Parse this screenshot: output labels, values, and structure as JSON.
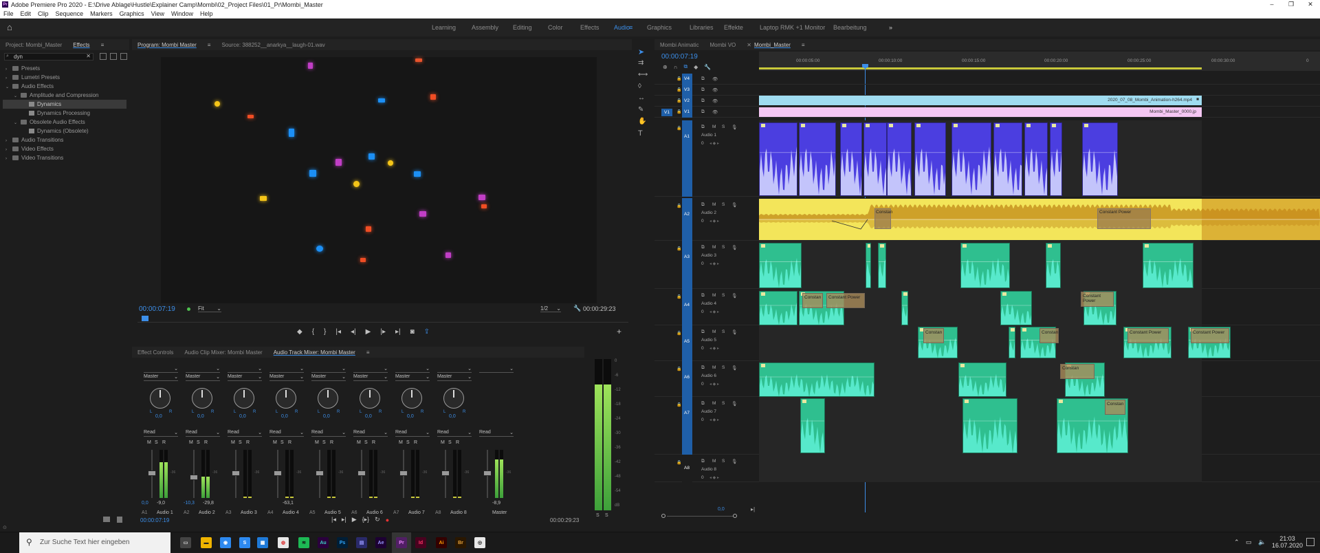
{
  "window": {
    "title": "Adobe Premiere Pro 2020 - E:\\Drive Ablage\\Hustle\\Explainer Camp\\Mombi\\02_Project Files\\01_Pr\\Mombi_Master",
    "min": "–",
    "max": "❐",
    "close": "✕"
  },
  "menu": [
    "File",
    "Edit",
    "Clip",
    "Sequence",
    "Markers",
    "Graphics",
    "View",
    "Window",
    "Help"
  ],
  "workspaces": [
    "Learning",
    "Assembly",
    "Editing",
    "Color",
    "Effects",
    "Audio",
    "Graphics",
    "Libraries",
    "Effekte",
    "Laptop RMK +1 Monitor",
    "Bearbeitung"
  ],
  "active_workspace": "Audio",
  "left_panel": {
    "tabs": [
      "Project: Mombi_Master",
      "Effects"
    ],
    "search_value": "dyn",
    "tree": [
      {
        "label": "Presets",
        "level": 0,
        "kind": "folder"
      },
      {
        "label": "Lumetri Presets",
        "level": 0,
        "kind": "folder"
      },
      {
        "label": "Audio Effects",
        "level": 0,
        "kind": "folder"
      },
      {
        "label": "Amplitude and Compression",
        "level": 1,
        "kind": "folder"
      },
      {
        "label": "Dynamics",
        "level": 2,
        "kind": "fx",
        "selected": true
      },
      {
        "label": "Dynamics Processing",
        "level": 2,
        "kind": "fx"
      },
      {
        "label": "Obsolete Audio Effects",
        "level": 1,
        "kind": "folder"
      },
      {
        "label": "Dynamics (Obsolete)",
        "level": 2,
        "kind": "fx"
      },
      {
        "label": "Audio Transitions",
        "level": 0,
        "kind": "folder"
      },
      {
        "label": "Video Effects",
        "level": 0,
        "kind": "folder"
      },
      {
        "label": "Video Transitions",
        "level": 0,
        "kind": "folder"
      }
    ]
  },
  "monitor": {
    "tab_program": "Program: Mombi Master",
    "tab_source": "Source: 388252__anarkya__laugh-01.wav",
    "timecode": "00:00:07:19",
    "fit": "Fit",
    "resolution": "1/2",
    "duration": "00:00:29:23"
  },
  "mixer": {
    "tabs": [
      "Effect Controls",
      "Audio Clip Mixer: Mombi Master",
      "Audio Track Mixer: Mombi Master"
    ],
    "timecode": "00:00:07:19",
    "duration": "00:00:29:23",
    "channels": [
      {
        "id": "A1",
        "name": "Audio 1",
        "output": "Master",
        "mode": "Read",
        "value": "-9,0",
        "pan": "0,0",
        "level": 0.75,
        "fader": 0.5
      },
      {
        "id": "A2",
        "name": "Audio 2",
        "output": "Master",
        "mode": "Read",
        "value": "-29,8",
        "vol": "-10,3",
        "pan": "0,0",
        "level": 0.45,
        "fader": 0.4
      },
      {
        "id": "A3",
        "name": "Audio 3",
        "output": "Master",
        "mode": "Read",
        "value": "",
        "pan": "0,0",
        "level": 0,
        "fader": 0.5
      },
      {
        "id": "A4",
        "name": "Audio 4",
        "output": "Master",
        "mode": "Read",
        "value": "-63,1",
        "pan": "0,0",
        "level": 0.05,
        "fader": 0.5
      },
      {
        "id": "A5",
        "name": "Audio 5",
        "output": "Master",
        "mode": "Read",
        "value": "",
        "pan": "0,0",
        "level": 0,
        "fader": 0.5
      },
      {
        "id": "A6",
        "name": "Audio 6",
        "output": "Master",
        "mode": "Read",
        "value": "",
        "pan": "0,0",
        "level": 0,
        "fader": 0.5
      },
      {
        "id": "A7",
        "name": "Audio 7",
        "output": "Master",
        "mode": "Read",
        "value": "",
        "pan": "0,0",
        "level": 0,
        "fader": 0.5
      },
      {
        "id": "A8",
        "name": "Audio 8",
        "output": "Master",
        "mode": "Read",
        "value": "",
        "pan": "0,0",
        "level": 0,
        "fader": 0.5
      },
      {
        "id": "M",
        "name": "Master",
        "output": "",
        "mode": "Read",
        "value": "-8,9",
        "pan": "",
        "level": 0.8,
        "fader": 0.5
      }
    ],
    "meter_scale": [
      "0",
      "-6",
      "-12",
      "-18",
      "-24",
      "-30",
      "-36",
      "-42",
      "-48",
      "-54",
      "dB"
    ],
    "sub_labels": [
      "0",
      "0",
      "dB"
    ],
    "solo_left": "S",
    "solo_right": "S"
  },
  "timeline": {
    "tabs": [
      "Mombi Animatic",
      "Mombi VO",
      "Mombi_Master"
    ],
    "timecode": "00:00:07:19",
    "ruler": [
      "00:00:05:00",
      "00:00:10:00",
      "00:00:15:00",
      "00:00:20:00",
      "00:00:25:00",
      "00:00:30:00"
    ],
    "zero": "0",
    "video_tracks": [
      "V4",
      "V3",
      "V2",
      "V1"
    ],
    "audio_tracks": [
      {
        "id": "A1",
        "name": "Audio 1"
      },
      {
        "id": "A2",
        "name": "Audio 2"
      },
      {
        "id": "A3",
        "name": "Audio 3"
      },
      {
        "id": "A4",
        "name": "Audio 4"
      },
      {
        "id": "A5",
        "name": "Audio 5"
      },
      {
        "id": "A6",
        "name": "Audio 6"
      },
      {
        "id": "A7",
        "name": "Audio 7"
      },
      {
        "id": "A8",
        "name": "Audio 8"
      }
    ],
    "clip_v2": "2020_07_08_Mombi_Animation-h264.mp4",
    "clip_v1": "Mombi_Master_0000.jp",
    "transition_label": "Constant Power",
    "transition_short": "Constan",
    "master_value": "0,0",
    "msr": [
      "M",
      "S"
    ]
  },
  "taskbar": {
    "search_placeholder": "Zur Suche Text hier eingeben",
    "time": "21:03",
    "date": "16.07.2020",
    "apps": [
      "Ps",
      "Ai",
      "Ae",
      "Pr",
      "Id",
      "Au",
      "Br"
    ]
  }
}
